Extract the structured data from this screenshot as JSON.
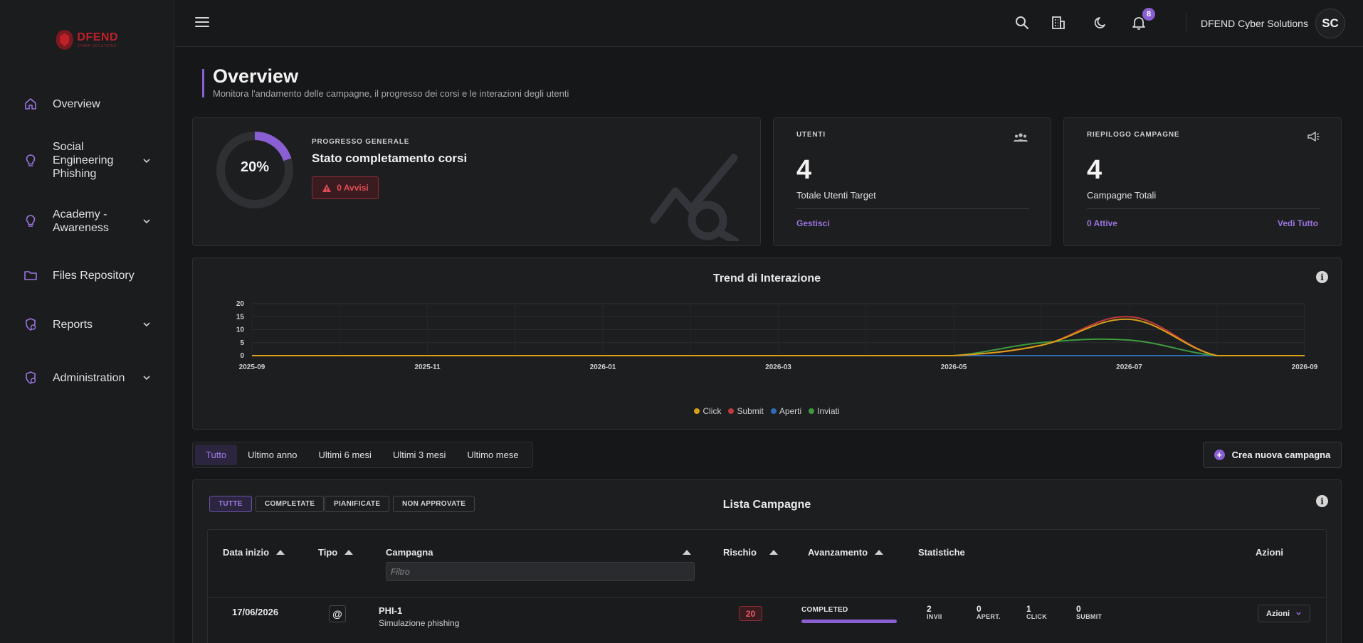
{
  "brand": {
    "name": "DFEND",
    "tagline": "CYBER SOLUTIONS"
  },
  "sidebar": {
    "items": [
      {
        "label": "Overview",
        "icon": "home-icon"
      },
      {
        "label": "Social Engineering Phishing",
        "icon": "bulb-icon"
      },
      {
        "label": "Academy - Awareness",
        "icon": "bulb-icon"
      },
      {
        "label": "Files Repository",
        "icon": "folder-icon"
      },
      {
        "label": "Reports",
        "icon": "shield-gear-icon"
      },
      {
        "label": "Administration",
        "icon": "shield-gear-icon"
      }
    ]
  },
  "topbar": {
    "org_name": "DFEND Cyber Solutions",
    "notifications": "8",
    "avatar_initials": "SC"
  },
  "header": {
    "title": "Overview",
    "subtitle": "Monitora l'andamento delle campagne, il progresso dei corsi e le interazioni degli utenti"
  },
  "progress_card": {
    "micro": "PROGRESSO GENERALE",
    "title": "Stato completamento corsi",
    "percent_label": "20%",
    "percent": 20,
    "warnings": "0 Avvisi"
  },
  "users_card": {
    "micro": "UTENTI",
    "value": "4",
    "label": "Totale Utenti Target",
    "link": "Gestisci"
  },
  "campaigns_card": {
    "micro": "RIEPILOGO CAMPAGNE",
    "value": "4",
    "label": "Campagne Totali",
    "link_left": "0 Attive",
    "link_right": "Vedi Tutto"
  },
  "chart_data": {
    "type": "line",
    "title": "Trend di Interazione",
    "x": [
      "2025-09",
      "2025-10",
      "2025-11",
      "2025-12",
      "2026-01",
      "2026-02",
      "2026-03",
      "2026-04",
      "2026-05",
      "2026-06",
      "2026-07",
      "2026-08",
      "2026-09"
    ],
    "tick_labels": [
      "2025-09",
      "2025-11",
      "2026-01",
      "2026-03",
      "2026-05",
      "2026-07",
      "2026-09"
    ],
    "y_ticks": [
      "20",
      "15",
      "10",
      "5",
      "0"
    ],
    "ylim": [
      0,
      20
    ],
    "grid": true,
    "legend_position": "bottom",
    "series": [
      {
        "name": "Click",
        "color": "#d8a017",
        "values": [
          0,
          0,
          0,
          0,
          0,
          0,
          0,
          0,
          0,
          4,
          14,
          0,
          0
        ]
      },
      {
        "name": "Submit",
        "color": "#c0393b",
        "values": [
          0,
          0,
          0,
          0,
          0,
          0,
          0,
          0,
          0,
          4,
          15,
          0,
          0
        ]
      },
      {
        "name": "Aperti",
        "color": "#2f6bb3",
        "values": [
          0,
          0,
          0,
          0,
          0,
          0,
          0,
          0,
          0,
          0,
          0,
          0,
          0
        ]
      },
      {
        "name": "Inviati",
        "color": "#3f9a3f",
        "values": [
          0,
          0,
          0,
          0,
          0,
          0,
          0,
          0,
          0,
          5,
          6,
          0,
          0
        ]
      }
    ]
  },
  "periods": {
    "all": "Tutto",
    "year": "Ultimo anno",
    "six": "Ultimi 6 mesi",
    "three": "Ultimi 3 mesi",
    "month": "Ultimo mese"
  },
  "create_label": "Crea nuova campagna",
  "list": {
    "title": "Lista Campagne",
    "chips": {
      "all": "TUTTE",
      "completed": "COMPLETATE",
      "planned": "PIANIFICATE",
      "unapproved": "NON APPROVATE"
    },
    "columns": {
      "date": "Data inizio",
      "type": "Tipo",
      "campaign": "Campagna",
      "risk": "Rischio",
      "progress": "Avanzamento",
      "stats": "Statistiche",
      "actions": "Azioni"
    },
    "filter_placeholder": "Filtro",
    "row": {
      "date": "17/06/2026",
      "type_symbol": "@",
      "name": "PHI-1",
      "desc": "Simulazione phishing",
      "risk": "20",
      "status": "COMPLETED",
      "progress": 100,
      "stats": [
        {
          "value": "2",
          "label": "INVII"
        },
        {
          "value": "0",
          "label": "APERT."
        },
        {
          "value": "1",
          "label": "CLICK"
        },
        {
          "value": "0",
          "label": "SUBMIT"
        }
      ],
      "actions_label": "Azioni"
    }
  }
}
